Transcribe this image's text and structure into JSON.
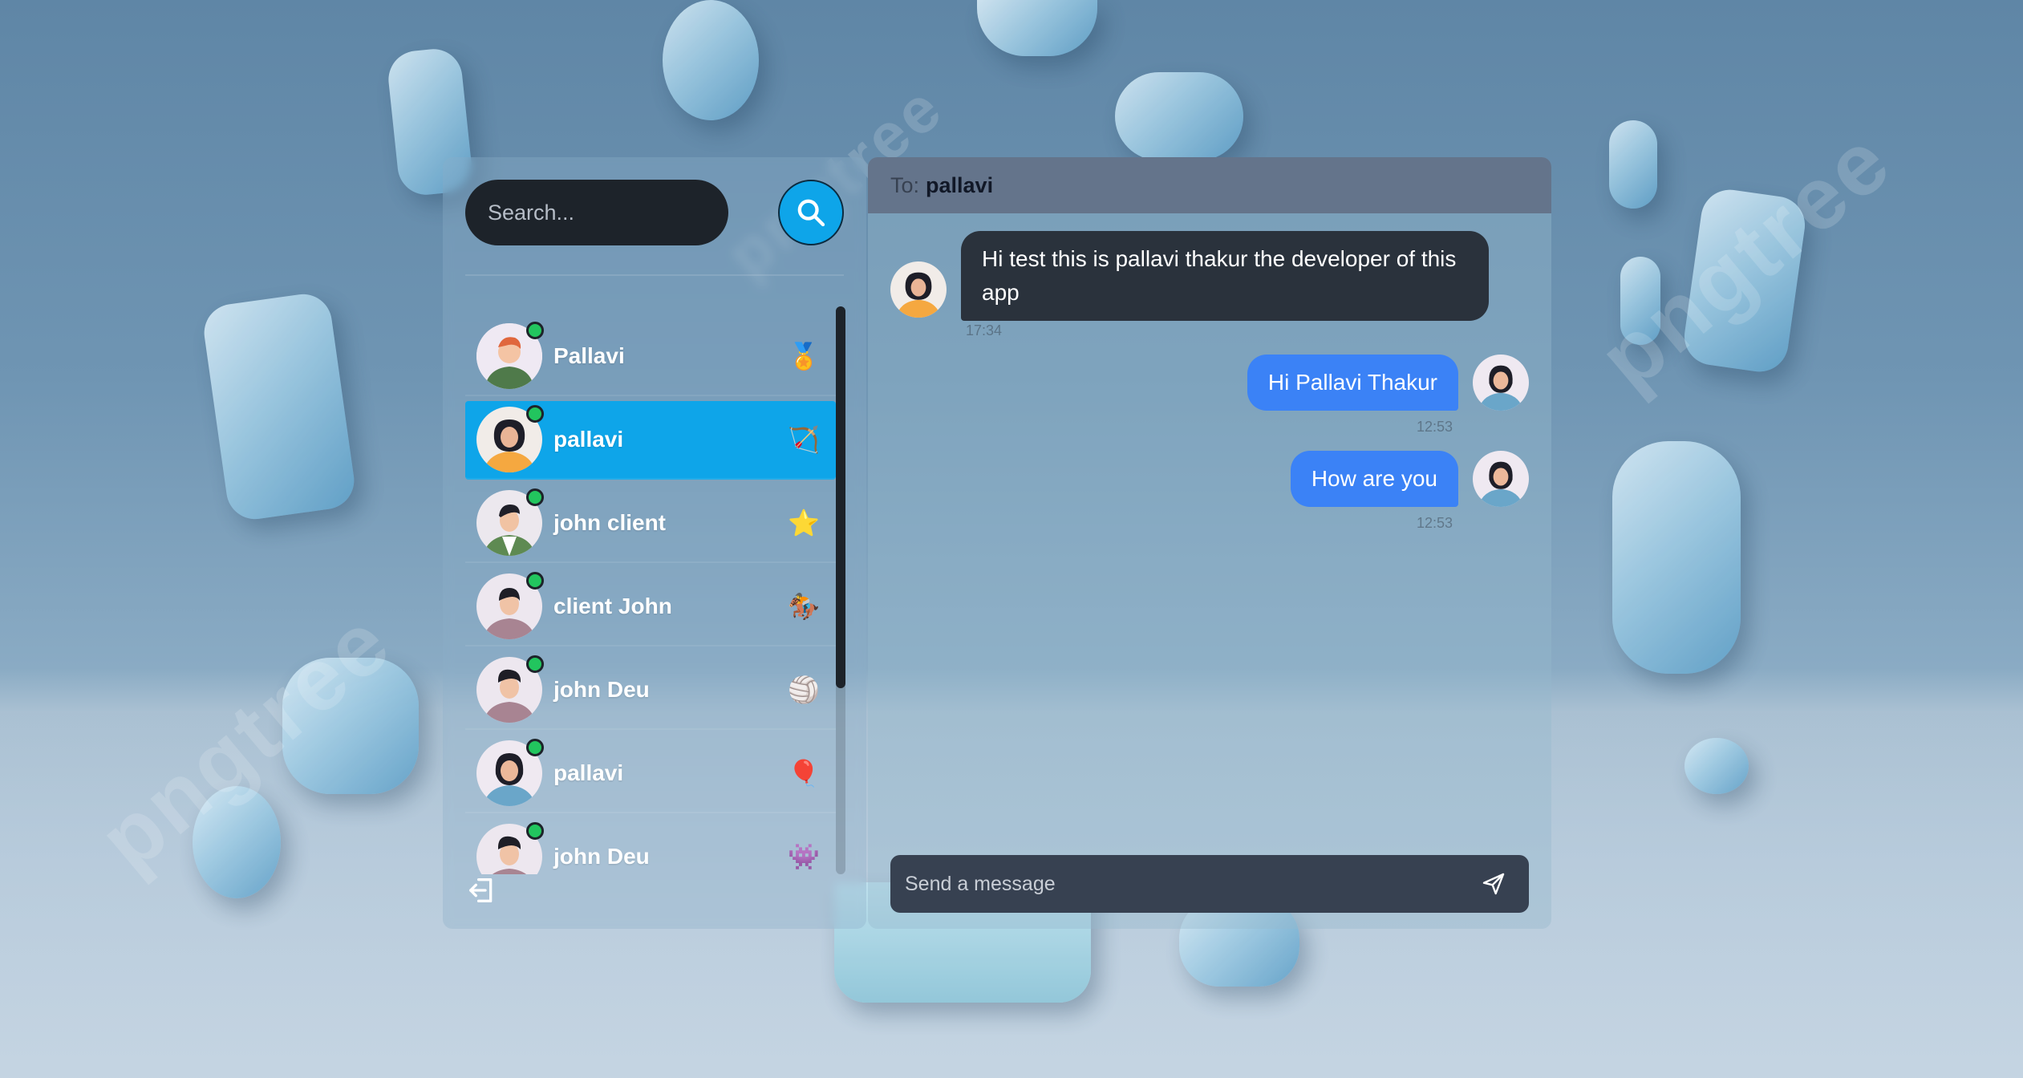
{
  "search": {
    "placeholder": "Search..."
  },
  "contacts": [
    {
      "name": "Pallavi",
      "emoji": "🏅",
      "online": true,
      "active": false
    },
    {
      "name": "pallavi",
      "emoji": "🏹",
      "online": true,
      "active": true
    },
    {
      "name": "john client",
      "emoji": "⭐",
      "online": true,
      "active": false
    },
    {
      "name": "client John",
      "emoji": "🏇",
      "online": true,
      "active": false
    },
    {
      "name": "john Deu",
      "emoji": "🏐",
      "online": true,
      "active": false
    },
    {
      "name": "pallavi",
      "emoji": "🎈",
      "online": true,
      "active": false
    },
    {
      "name": "john Deu",
      "emoji": "👾",
      "online": true,
      "active": false
    }
  ],
  "chat": {
    "to_label": "To:",
    "to_name": "pallavi",
    "messages": [
      {
        "text": "Hi test this is pallavi thakur the developer of this app",
        "time": "17:34",
        "direction": "received"
      },
      {
        "text": "Hi Pallavi Thakur",
        "time": "12:53",
        "direction": "sent"
      },
      {
        "text": "How are you",
        "time": "12:53",
        "direction": "sent"
      }
    ],
    "composer_placeholder": "Send a message"
  },
  "colors": {
    "accent": "#0ea5e9",
    "sent_bubble": "#3b82f6",
    "received_bubble": "#2a323c",
    "header_bg": "#64748b",
    "online": "#22c55e"
  },
  "watermark": "pngtree"
}
